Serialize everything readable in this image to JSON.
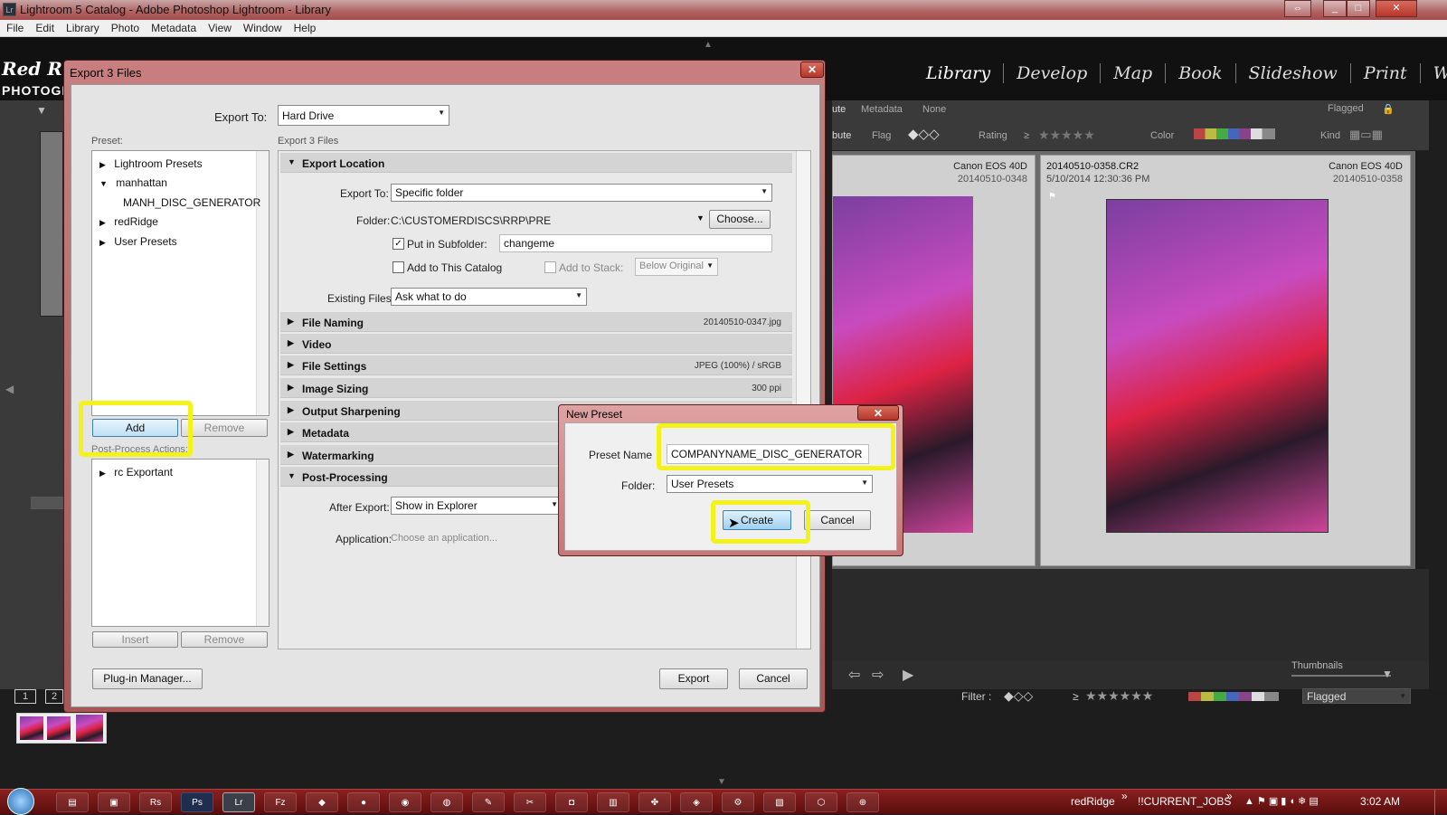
{
  "window": {
    "title": "Lightroom 5 Catalog - Adobe Photoshop Lightroom - Library",
    "app_badge": "Lr"
  },
  "menu": [
    "File",
    "Edit",
    "Library",
    "Photo",
    "Metadata",
    "View",
    "Window",
    "Help"
  ],
  "lr": {
    "logo_line1": "Red R",
    "logo_line2": "PHOTOGI",
    "modules": [
      "Library",
      "Develop",
      "Map",
      "Book",
      "Slideshow",
      "Print",
      "Web"
    ],
    "filter_row1": {
      "items": [
        "ute",
        "Metadata",
        "None"
      ],
      "preset": "Flagged"
    },
    "filter_row2": {
      "attribute": "bute",
      "flag": "Flag",
      "rating": "Rating",
      "rating_op": "≥",
      "color": "Color",
      "kind": "Kind"
    },
    "cells": [
      {
        "camera": "Canon EOS 40D",
        "filename": "20140510-0348"
      },
      {
        "camera": "Canon EOS 40D",
        "filename": "20140510-0358",
        "title": "20140510-0358.CR2",
        "date": "5/10/2014 12:30:36 PM"
      }
    ],
    "toolbar": {
      "thumbnails": "Thumbnails"
    },
    "filmstrip_filter": {
      "label": "Filter :",
      "rating_op": "≥",
      "preset": "Flagged"
    },
    "page_numbers": [
      "1",
      "2"
    ]
  },
  "export": {
    "title": "Export 3 Files",
    "export_to_label": "Export To:",
    "export_to_value": "Hard Drive",
    "preset_label": "Preset:",
    "section_caption": "Export 3 Files",
    "presets": [
      {
        "label": "Lightroom Presets",
        "arrow": "▶"
      },
      {
        "label": "manhattan",
        "arrow": "▼"
      },
      {
        "label": "MANH_DISC_GENERATOR",
        "arrow": ""
      },
      {
        "label": "redRidge",
        "arrow": "▶"
      },
      {
        "label": "User Presets",
        "arrow": "▶"
      }
    ],
    "add_label": "Add",
    "remove_label": "Remove",
    "post_process_label": "Post-Process Actions:",
    "post_process_items": [
      {
        "label": "rc Exportant",
        "arrow": "▶"
      }
    ],
    "insert_label": "Insert",
    "remove2_label": "Remove",
    "plugin_manager_label": "Plug-in Manager...",
    "export_button": "Export",
    "cancel_button": "Cancel",
    "location": {
      "header": "Export Location",
      "export_to_label": "Export To:",
      "export_to_value": "Specific folder",
      "folder_label": "Folder:",
      "folder_value": "C:\\CUSTOMERDISCS\\RRP\\PRE",
      "choose_label": "Choose...",
      "subfolder_label": "Put in Subfolder:",
      "subfolder_checked": "✓",
      "subfolder_value": "changeme",
      "add_catalog_label": "Add to This Catalog",
      "add_stack_label": "Add to Stack:",
      "stack_value": "Below Original",
      "existing_label": "Existing Files:",
      "existing_value": "Ask what to do"
    },
    "sections": [
      {
        "name": "File Naming",
        "summary": "20140510-0347.jpg"
      },
      {
        "name": "Video",
        "summary": ""
      },
      {
        "name": "File Settings",
        "summary": "JPEG (100%) / sRGB"
      },
      {
        "name": "Image Sizing",
        "summary": "300 ppi"
      },
      {
        "name": "Output Sharpening",
        "summary": ""
      },
      {
        "name": "Metadata",
        "summary": ""
      },
      {
        "name": "Watermarking",
        "summary": ""
      }
    ],
    "post": {
      "header": "Post-Processing",
      "after_label": "After Export:",
      "after_value": "Show in Explorer",
      "app_label": "Application:",
      "app_placeholder": "Choose an application..."
    },
    "arrows": {
      "open": "▼",
      "closed": "▶"
    }
  },
  "new_preset": {
    "title": "New Preset",
    "name_label": "Preset Name",
    "name_value": "COMPANYNAME_DISC_GENERATOR",
    "folder_label": "Folder:",
    "folder_value": "User Presets",
    "create_label": "Create",
    "cancel_label": "Cancel"
  },
  "taskbar": {
    "toolbar1": "redRidge",
    "toolbar2": "!!CURRENT_JOBS",
    "clock": "3:02 AM",
    "apps": [
      "Ps",
      "Lr",
      "Fz",
      "Rs"
    ]
  },
  "colors": {
    "highlight": "#f3f21a",
    "dialog_frame": "#b85c5c",
    "create_button": "#9fd0f0"
  }
}
